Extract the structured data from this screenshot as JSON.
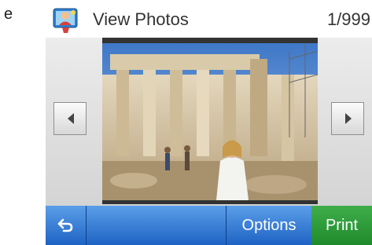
{
  "step_letter": "e",
  "header": {
    "icon": "photo-app-icon",
    "title": "View Photos",
    "counter": "1/999"
  },
  "navigation": {
    "prev_icon": "left-arrow-icon",
    "next_icon": "right-arrow-icon"
  },
  "photo": {
    "description_icon": "photo-preview"
  },
  "bottom_bar": {
    "back_icon": "back-arrow-icon",
    "options_label": "Options",
    "print_label": "Print"
  },
  "colors": {
    "bar_blue": "#1e63c4",
    "print_green": "#1f8a2c"
  }
}
